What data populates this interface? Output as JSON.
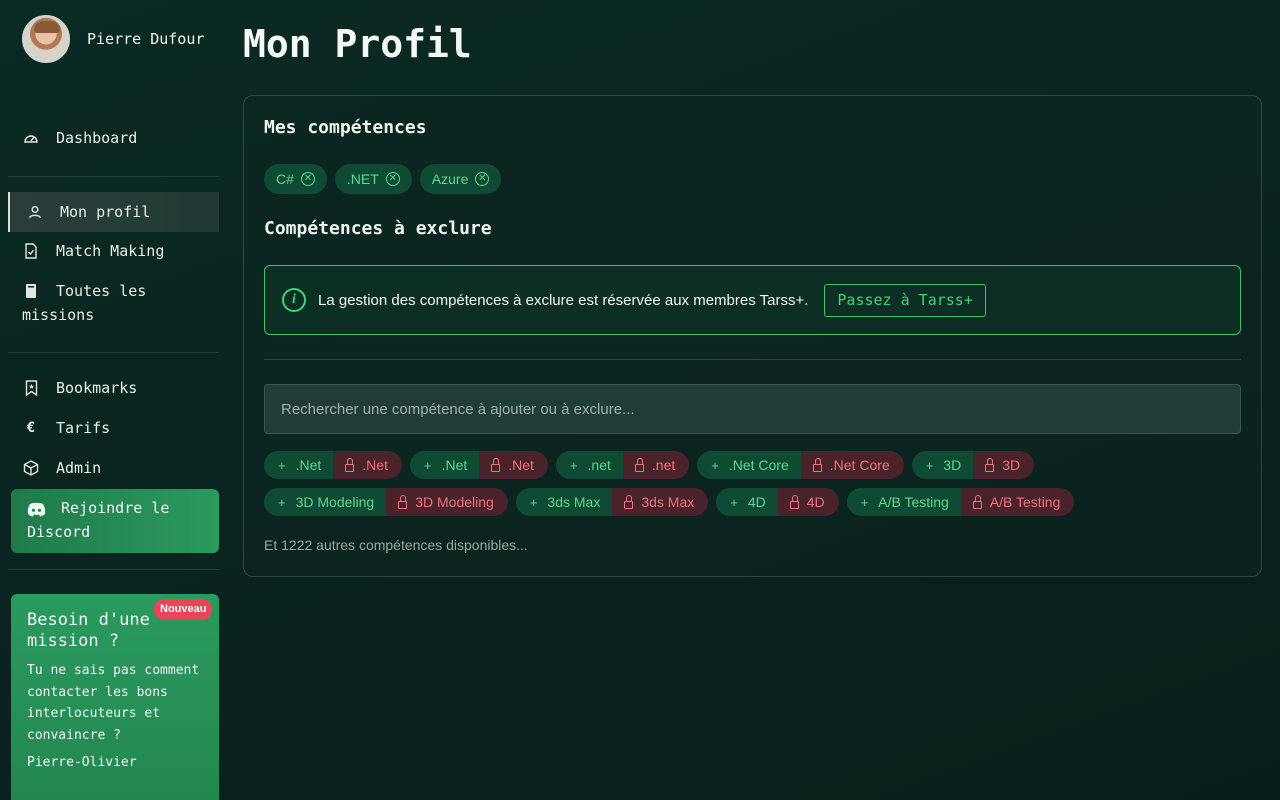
{
  "user": {
    "name": "Pierre Dufour"
  },
  "nav": {
    "dashboard": "Dashboard",
    "profile": "Mon profil",
    "match": "Match Making",
    "missions_line1": "Toutes les",
    "missions_line2": "missions",
    "bookmarks": "Bookmarks",
    "pricing": "Tarifs",
    "admin": "Admin",
    "discord_line1": "Rejoindre le",
    "discord_line2": "Discord"
  },
  "promo": {
    "badge": "Nouveau",
    "title_line1": "Besoin d'une",
    "title_line2": "mission ?",
    "text": "Tu ne sais pas comment contacter les bons interlocuteurs et convaincre ?",
    "author": "Pierre-Olivier"
  },
  "main": {
    "title": "Mon Profil",
    "skills_title": "Mes compétences",
    "skills": [
      "C#",
      ".NET",
      "Azure"
    ],
    "exclude_title": "Compétences à exclure",
    "info_text": "La gestion des compétences à exclure est réservée aux membres Tarss+.",
    "upgrade_label": "Passez à Tarss+",
    "search_placeholder": "Rechercher une compétence à ajouter ou à exclure...",
    "suggestions_row1": [
      ".Net",
      ".Net",
      ".net",
      ".Net Core",
      "3D"
    ],
    "suggestions_row2": [
      "3D Modeling",
      "3ds Max",
      "4D",
      "A/B Testing"
    ],
    "more_text": "Et 1222 autres compétences disponibles..."
  },
  "colors": {
    "accent": "#3fd47a",
    "exclude": "#f07080",
    "background": "#0a2520"
  },
  "icons": {
    "dashboard": "gauge-icon",
    "profile": "user-icon",
    "match": "file-check-icon",
    "missions": "document-icon",
    "bookmarks": "bookmark-icon",
    "pricing": "euro-icon",
    "admin": "cube-icon",
    "discord": "discord-icon",
    "info": "info-icon",
    "remove": "close-circle-icon",
    "add": "plus-icon",
    "lock": "lock-icon"
  }
}
